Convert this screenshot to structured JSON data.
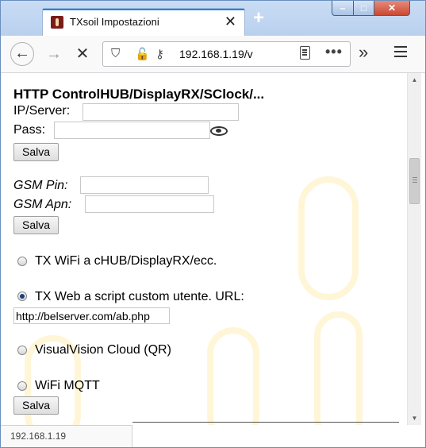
{
  "browser": {
    "tab_title": "TXsoil Impostazioni",
    "tab_close": "✕",
    "new_tab": "+",
    "url": "192.168.1.19/v",
    "status_url": "192.168.1.19",
    "window_controls": {
      "minimize": "–",
      "maximize": "□",
      "close": "✕"
    }
  },
  "form": {
    "http_heading": "HTTP ControlHUB/DisplayRX/SClock/...",
    "ip_label": "IP/Server:",
    "ip_value": "",
    "pass_label": "Pass:",
    "pass_value": "",
    "save_label": "Salva",
    "gsm_pin_label": "GSM Pin:",
    "gsm_pin_value": "",
    "gsm_apn_label": "GSM Apn:",
    "gsm_apn_value": "",
    "options": [
      {
        "label": "TX WiFi a cHUB/DisplayRX/ecc.",
        "selected": false
      },
      {
        "label": "TX Web a script custom utente. URL:",
        "selected": true
      },
      {
        "label": "VisualVision Cloud (QR)",
        "selected": false
      },
      {
        "label": "WiFi MQTT",
        "selected": false
      }
    ],
    "custom_url_value": "http://belserver.com/ab.php"
  },
  "colors": {
    "accent": "#0a84ff",
    "watermark": "#fff3d0",
    "radio_dot": "#1e3f7a"
  }
}
